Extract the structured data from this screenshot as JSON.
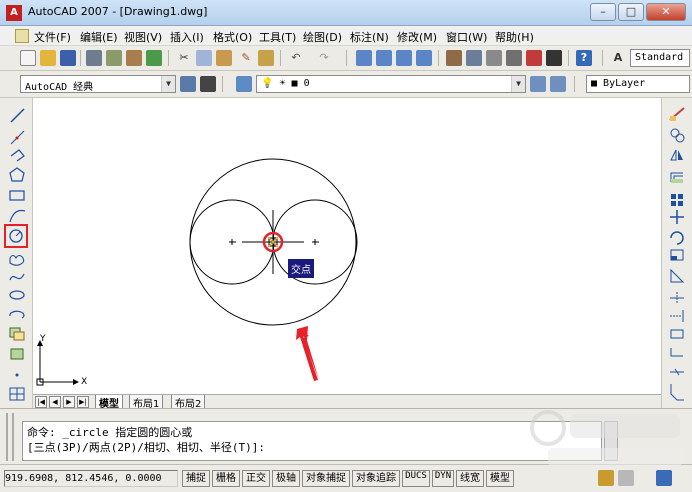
{
  "window": {
    "title": "AutoCAD 2007 - [Drawing1.dwg]",
    "icon_name": "autocad-a-icon",
    "icon_text": "A"
  },
  "menu": {
    "items": [
      "文件(F)",
      "编辑(E)",
      "视图(V)",
      "插入(I)",
      "格式(O)",
      "工具(T)",
      "绘图(D)",
      "标注(N)",
      "修改(M)",
      "窗口(W)",
      "帮助(H)"
    ]
  },
  "toolbar": {
    "text_style": "Standard",
    "workspace": "AutoCAD 经典",
    "layer": "0",
    "color": "ByLayer"
  },
  "drawing": {
    "snap_tooltip": "交点",
    "ucs_x": "X",
    "ucs_y": "Y",
    "arrow_color": "#e8202a",
    "highlight_color": "#e8202a"
  },
  "tabs": [
    "模型",
    "布局1",
    "布局2"
  ],
  "command": {
    "line1": "命令: _circle 指定圆的圆心或",
    "line2": "[三点(3P)/两点(2P)/相切、相切、半径(T)]:"
  },
  "status": {
    "coords": "919.6908, 812.4546, 0.0000",
    "buttons": [
      "捕捉",
      "栅格",
      "正交",
      "极轴",
      "对象捕捉",
      "对象追踪",
      "DUCS",
      "DYN",
      "线宽",
      "模型"
    ]
  }
}
